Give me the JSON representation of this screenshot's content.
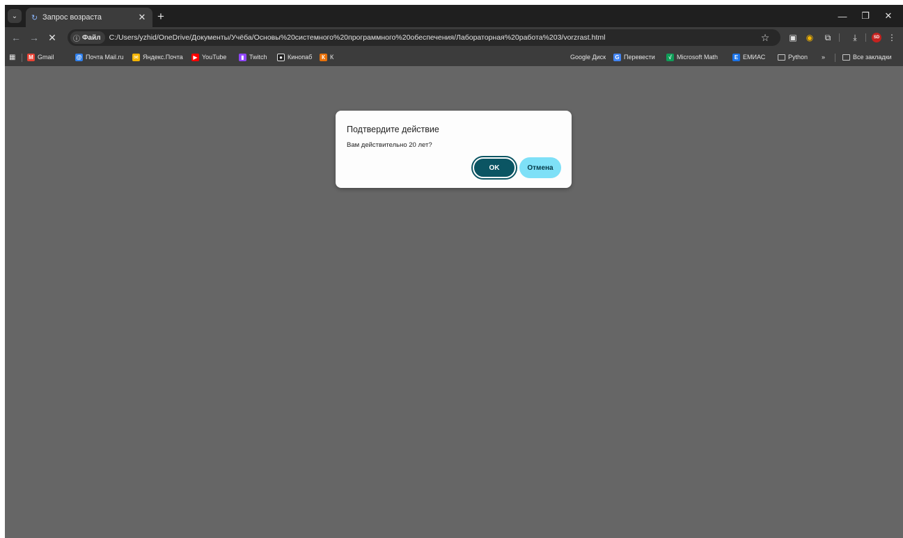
{
  "tab": {
    "title": "Запрос возраста"
  },
  "toolbar": {
    "site_chip": "Файл",
    "url": "C:/Users/yzhid/OneDrive/Документы/Учёба/Основы%20системного%20программного%20обеспечения/Лабораторная%20работа%203/vorzrast.html"
  },
  "bookmarks": [
    {
      "label": "Gmail",
      "color": "#ea4335",
      "glyph": "M"
    },
    {
      "label": "Почта Mail.ru",
      "color": "#2f80ed",
      "glyph": "@"
    },
    {
      "label": "Яндекс.Почта",
      "color": "#f4b400",
      "glyph": "✉"
    },
    {
      "label": "YouTube",
      "color": "#ff0000",
      "glyph": "▶"
    },
    {
      "label": "Twitch",
      "color": "#9146ff",
      "glyph": "▮"
    },
    {
      "label": "Кинопаб",
      "color": "#1f1f1f",
      "glyph": "●"
    },
    {
      "label": "К",
      "color": "#e8710a",
      "glyph": "К"
    },
    {
      "label": "Google Диск",
      "color": "#188038",
      "glyph": "▲"
    },
    {
      "label": "Перевести",
      "color": "#4285f4",
      "glyph": "G"
    },
    {
      "label": "Microsoft Math",
      "color": "#0f9d58",
      "glyph": "√"
    },
    {
      "label": "ЕМИАС",
      "color": "#1a73e8",
      "glyph": "E"
    },
    {
      "label": "Python",
      "folder": true
    },
    {
      "label": "Все закладки",
      "folder": true
    }
  ],
  "bookmarks_overflow": "»",
  "dialog": {
    "title": "Подтвердите действие",
    "message": "Вам действительно 20 лет?",
    "ok_label": "OK",
    "cancel_label": "Отмена"
  },
  "avatar": {
    "initials": "SD",
    "color": "#c5221f"
  },
  "colors": {
    "page_bg": "#666666",
    "ok_button": "#0b5563",
    "cancel_button": "#7ee0f7"
  }
}
